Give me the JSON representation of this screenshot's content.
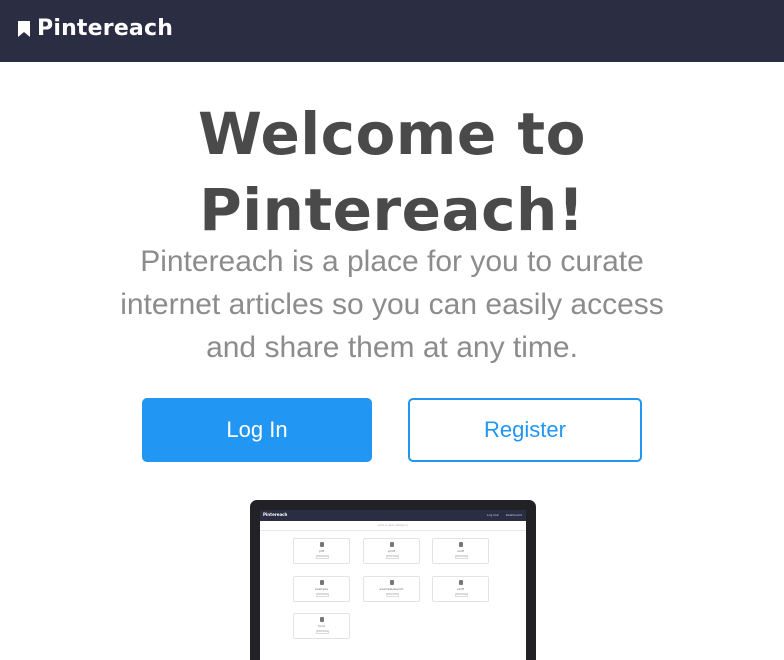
{
  "navbar": {
    "brand": "Pintereach",
    "brand_icon": "bookmark-icon",
    "background": "#2b2d42"
  },
  "hero": {
    "title": "Welcome to Pintereach!",
    "tagline": "Pintereach is a place for you to curate internet articles so you can easily access and share them at any time."
  },
  "buttons": {
    "login_label": "Log In",
    "register_label": "Register",
    "accent": "#2196f3"
  },
  "preview": {
    "brand": "Pintereach",
    "links": [
      "Log Out",
      "Dashboard"
    ],
    "subheader": "Add a new category",
    "cards": [
      {
        "name": "pdf",
        "button": "View Items"
      },
      {
        "name": "pndf",
        "button": "View Items"
      },
      {
        "name": "sndf",
        "button": "View Items"
      },
      {
        "name": "example",
        "button": "View Items"
      },
      {
        "name": "example/search",
        "button": "View Items"
      },
      {
        "name": "stuff",
        "button": "View Items"
      },
      {
        "name": "food",
        "button": "View Items"
      }
    ]
  }
}
